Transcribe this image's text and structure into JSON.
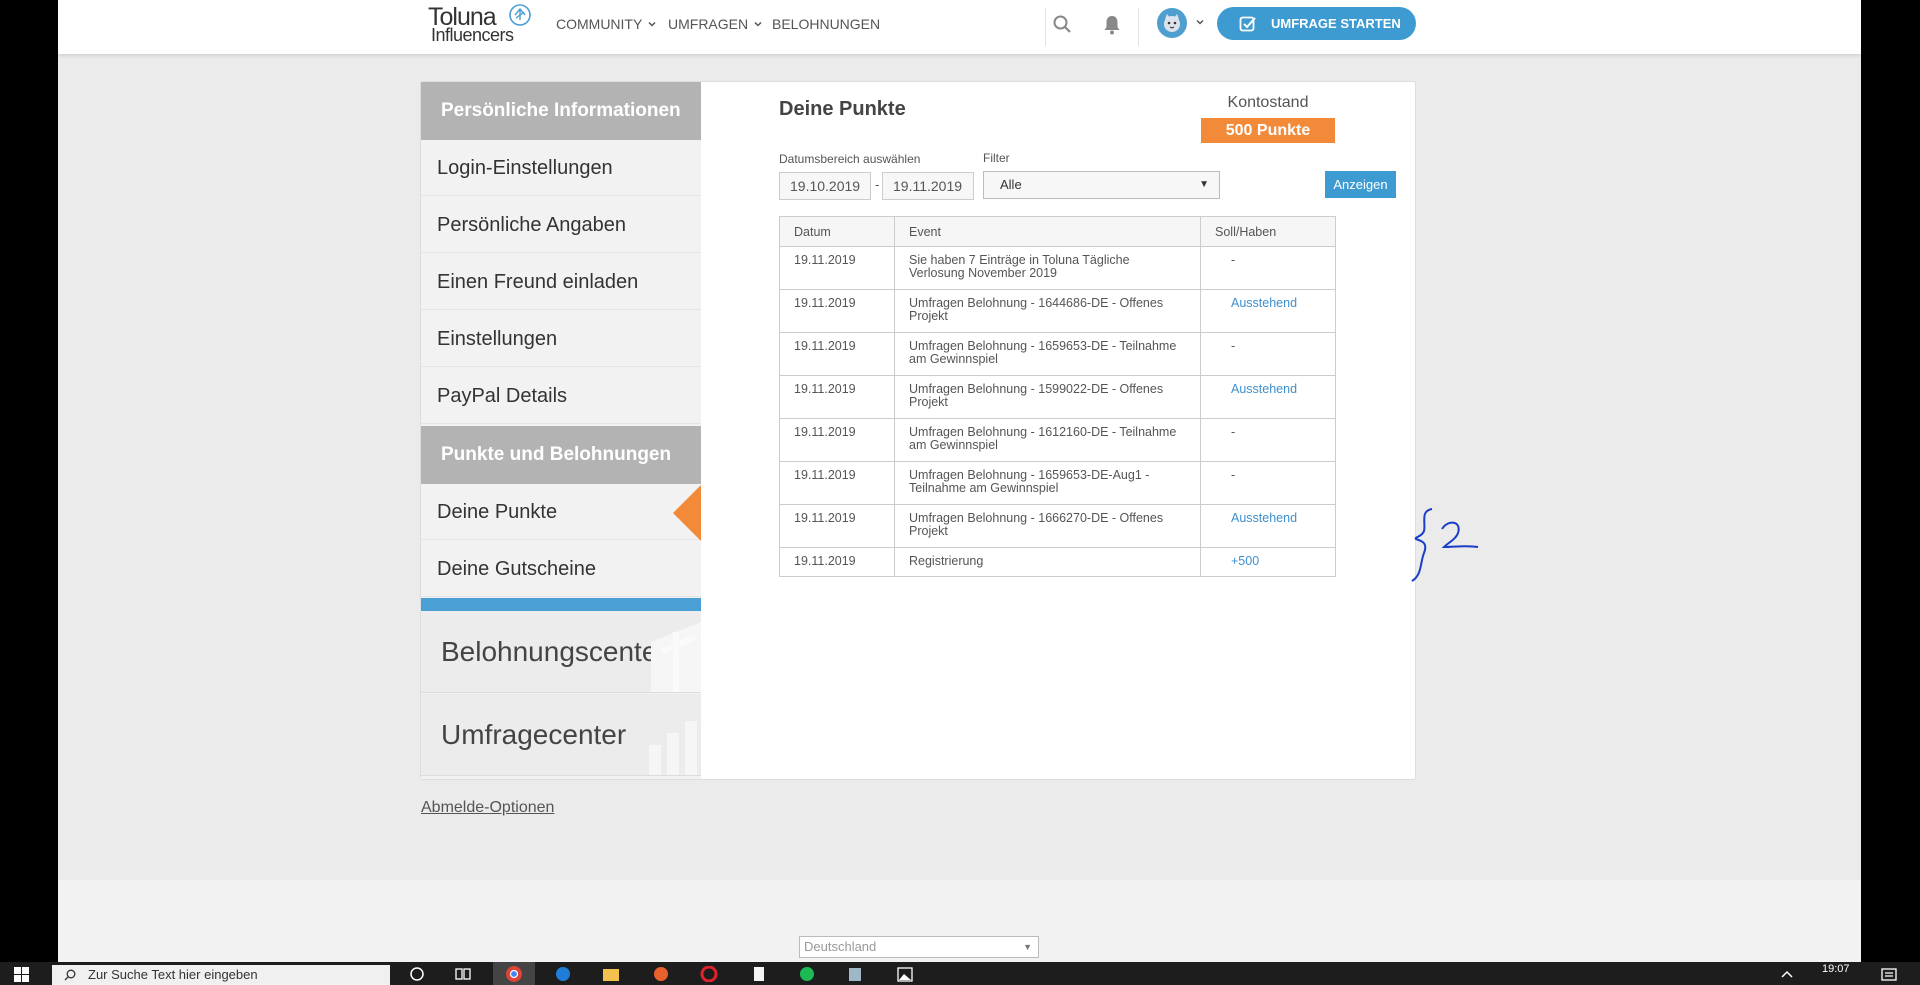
{
  "header": {
    "logo_line1": "Toluna",
    "logo_line2": "Influencers",
    "nav": [
      {
        "label": "COMMUNITY"
      },
      {
        "label": "UMFRAGEN"
      },
      {
        "label": "BELOHNUNGEN"
      }
    ],
    "start_button_label": "UMFRAGE STARTEN"
  },
  "sidebar": {
    "section1_title": "Persönliche Informationen",
    "section1_items": [
      {
        "label": "Login-Einstellungen"
      },
      {
        "label": "Persönliche Angaben"
      },
      {
        "label": "Einen Freund einladen"
      },
      {
        "label": "Einstellungen"
      },
      {
        "label": "PayPal Details"
      }
    ],
    "section2_title": "Punkte und Belohnungen",
    "section2_items": [
      {
        "label": "Deine Punkte",
        "active": true
      },
      {
        "label": "Deine Gutscheine"
      }
    ],
    "reward_center": "Belohnungscenter",
    "survey_center": "Umfragecenter"
  },
  "main": {
    "title": "Deine Punkte",
    "balance_label": "Kontostand",
    "balance_value": "500 Punkte",
    "date_range_label": "Datumsbereich auswählen",
    "date_from": "19.10.2019",
    "date_separator": "-",
    "date_to": "19.11.2019",
    "filter_label": "Filter",
    "filter_value": "Alle",
    "show_button": "Anzeigen",
    "table": {
      "headers": [
        "Datum",
        "Event",
        "Soll/Haben"
      ],
      "rows": [
        {
          "date": "19.11.2019",
          "event": "Sie haben 7 Einträge in Toluna Tägliche Verlosung November 2019",
          "amount": "-"
        },
        {
          "date": "19.11.2019",
          "event": "Umfragen Belohnung - 1644686-DE - Offenes Projekt",
          "amount": "Ausstehend"
        },
        {
          "date": "19.11.2019",
          "event": "Umfragen Belohnung - 1659653-DE - Teilnahme am Gewinnspiel",
          "amount": "-"
        },
        {
          "date": "19.11.2019",
          "event": "Umfragen Belohnung - 1599022-DE - Offenes Projekt",
          "amount": "Ausstehend"
        },
        {
          "date": "19.11.2019",
          "event": "Umfragen Belohnung - 1612160-DE - Teilnahme am Gewinnspiel",
          "amount": "-"
        },
        {
          "date": "19.11.2019",
          "event": "Umfragen Belohnung - 1659653-DE-Aug1 - Teilnahme am Gewinnspiel",
          "amount": "-"
        },
        {
          "date": "19.11.2019",
          "event": "Umfragen Belohnung - 1666270-DE - Offenes Projekt",
          "amount": "Ausstehend"
        },
        {
          "date": "19.11.2019",
          "event": "Registrierung",
          "amount": "+500"
        }
      ]
    },
    "logout_link": "Abmelde-Optionen"
  },
  "footer": {
    "country": "Deutschland"
  },
  "taskbar": {
    "search_placeholder": "Zur Suche Text hier eingeben",
    "clock": "19:07"
  },
  "colors": {
    "accent_blue": "#3d9bd1",
    "accent_orange": "#f28a3a",
    "menu_header_gray": "#b3b3b3"
  },
  "icons": [
    "logo-mark-icon",
    "chevron-down-icon",
    "search-icon",
    "bell-icon",
    "avatar",
    "checkbox-icon",
    "windows-start-icon",
    "taskbar-search-icon"
  ]
}
